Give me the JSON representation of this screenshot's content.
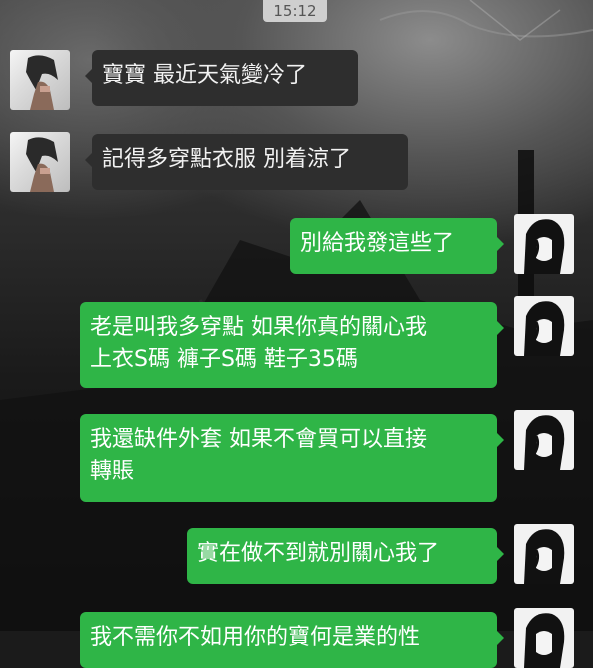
{
  "status": {
    "time": "15:12"
  },
  "messages": [
    {
      "side": "left",
      "text": "寶寶 最近天氣變冷了"
    },
    {
      "side": "left",
      "text": "記得多穿點衣服 別着涼了"
    },
    {
      "side": "right",
      "text": "別給我發這些了"
    },
    {
      "side": "right",
      "text_line1": "老是叫我多穿點 如果你真的關心我",
      "text_line2": "上衣S碼 褲子S碼 鞋子35碼"
    },
    {
      "side": "right",
      "text_line1": "我還缺件外套 如果不會買可以直接",
      "text_line2": "轉賬"
    },
    {
      "side": "right",
      "text": "實在做不到就別關心我了"
    },
    {
      "side": "right",
      "text": "我不需你不如用你的寶何是業的性"
    }
  ],
  "colors": {
    "self_bubble": "#2fb547",
    "other_bubble": "#2e2e2e"
  }
}
